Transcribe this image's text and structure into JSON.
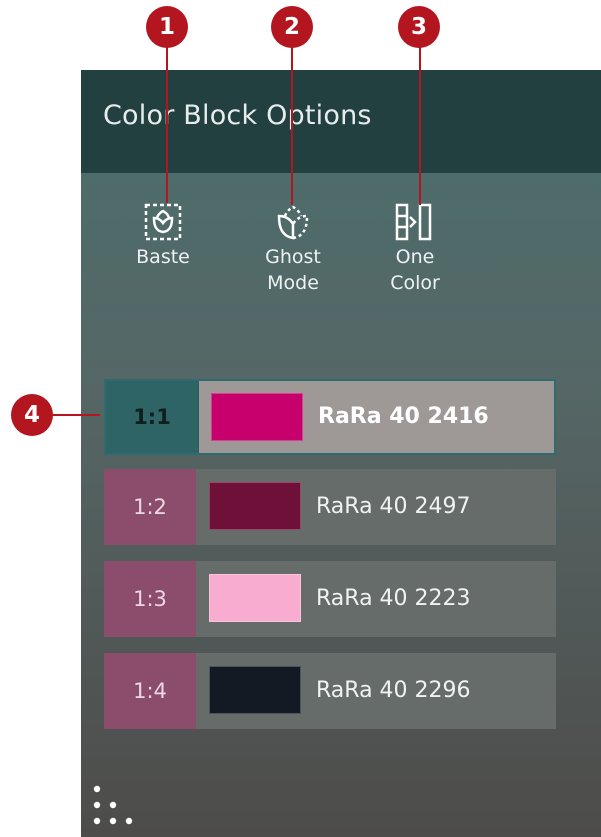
{
  "panel": {
    "title": "Color Block Options"
  },
  "tools": [
    {
      "label_line1": "Baste",
      "label_line2": "",
      "icon": "baste-icon"
    },
    {
      "label_line1": "Ghost",
      "label_line2": "Mode",
      "icon": "ghost-mode-icon"
    },
    {
      "label_line1": "One",
      "label_line2": "Color",
      "icon": "one-color-icon"
    }
  ],
  "color_blocks": [
    {
      "index": "1:1",
      "name": "RaRa 40 2416",
      "color": "#c8006e",
      "selected": true
    },
    {
      "index": "1:2",
      "name": "RaRa 40 2497",
      "color": "#6e1038",
      "selected": false
    },
    {
      "index": "1:3",
      "name": "RaRa 40 2223",
      "color": "#f7acd0",
      "selected": false
    },
    {
      "index": "1:4",
      "name": "RaRa 40 2296",
      "color": "#121a24",
      "selected": false
    }
  ],
  "callouts": [
    "1",
    "2",
    "3",
    "4"
  ],
  "colors": {
    "header": "#22403f",
    "index_tab": "#8c4c6b",
    "selected_index_tab": "#2f6466",
    "callout": "#b3161f"
  },
  "footer_icon": "grip-dots-icon"
}
